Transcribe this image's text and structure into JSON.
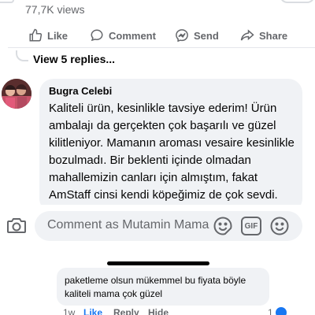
{
  "post": {
    "views": "77,7K views",
    "actions": {
      "like": "Like",
      "comment": "Comment",
      "send": "Send",
      "share": "Share"
    },
    "view_replies": "View 5 replies..."
  },
  "comment": {
    "author": "Bugra Celebi",
    "text": "Kaliteli ürün, kesinlikle tavsiye ederim! Ürün ambalajı da gerçekten çok başarılı ve güzel kilitleniyor. Mamanın aroması vesaire kesinlikle bozulmadı. Bir beklenti içinde olmadan mahallemizin canları için almıştım, fakat AmStaff cinsi kendi köpeğimiz de çok sevdi."
  },
  "composer": {
    "placeholder": "Comment as Mutamin Mama",
    "gif_label": "GIF"
  },
  "reply": {
    "text": "paketleme olsun mükemmel bu fiyata böyle kaliteli mama çok güzel",
    "time": "1w",
    "like": "Like",
    "reply": "Reply",
    "hide": "Hide",
    "like_count": "1"
  },
  "icons": {
    "like": "thumbs-up-icon",
    "comment": "speech-bubble-icon",
    "send": "messenger-icon",
    "share": "share-arrow-icon",
    "camera": "camera-icon",
    "sticker": "sticker-icon",
    "gif": "gif-icon",
    "emoji": "emoji-icon"
  },
  "colors": {
    "accent": "#1877f2",
    "secondary_text": "#65676b",
    "bubble_bg": "#f0f2f5"
  }
}
